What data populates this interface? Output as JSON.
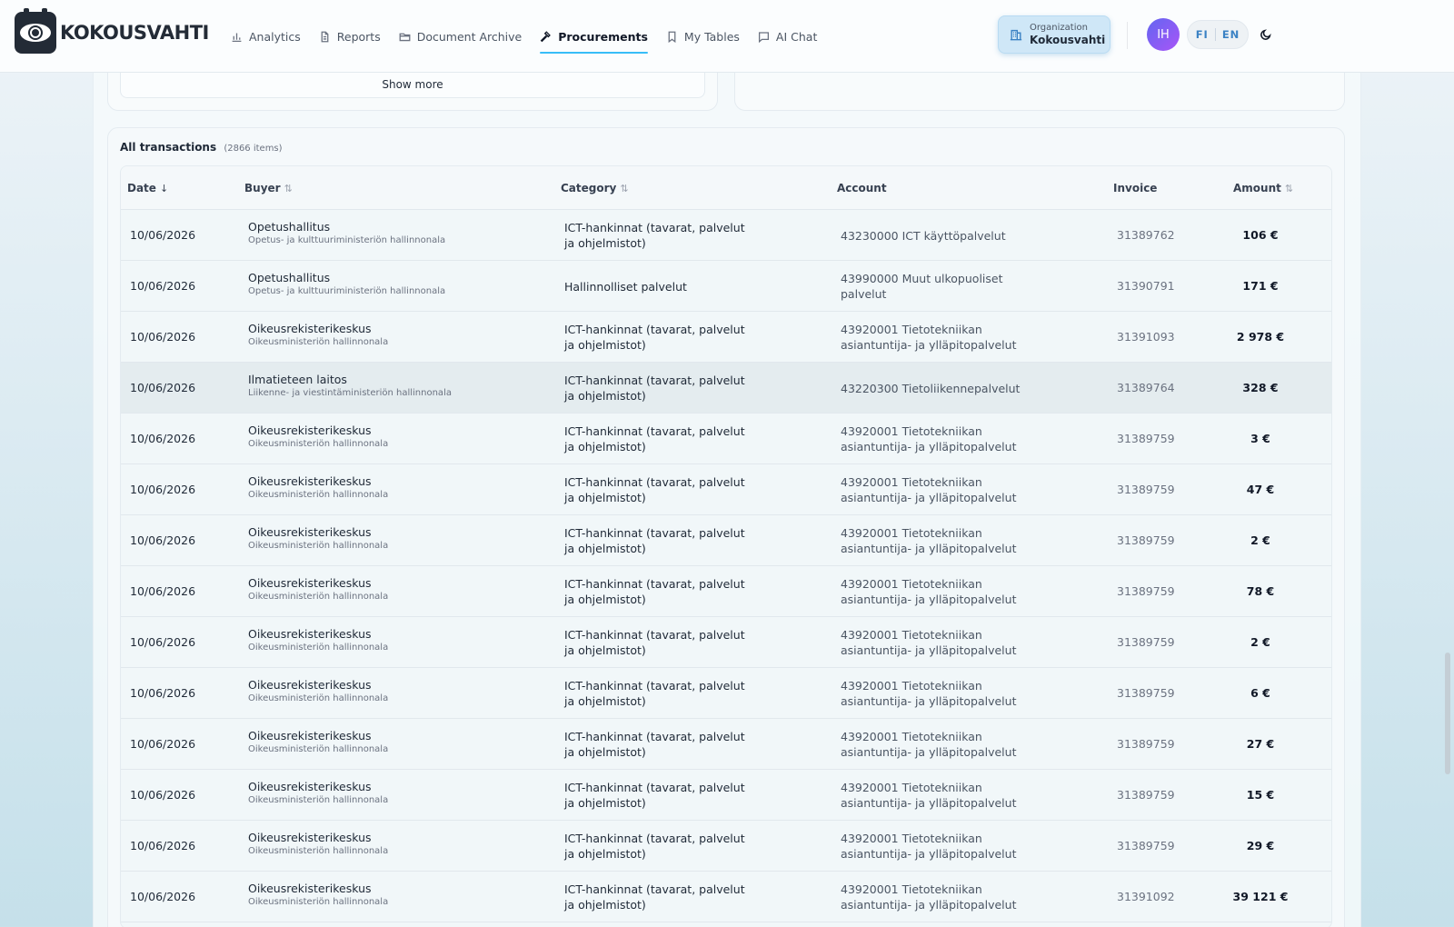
{
  "app": {
    "logo_text": "KOKOUSVAHTI"
  },
  "nav": {
    "items": [
      {
        "label": "Analytics",
        "icon": "bar-chart-icon"
      },
      {
        "label": "Reports",
        "icon": "document-icon"
      },
      {
        "label": "Document Archive",
        "icon": "folder-icon"
      },
      {
        "label": "Procurements",
        "icon": "gavel-icon",
        "active": true
      },
      {
        "label": "My Tables",
        "icon": "bookmark-icon"
      },
      {
        "label": "AI Chat",
        "icon": "chat-icon"
      }
    ]
  },
  "org": {
    "label": "Organization",
    "name": "Kokousvahti"
  },
  "user": {
    "initials": "IH"
  },
  "lang": {
    "fi": "FI",
    "en": "EN"
  },
  "show_more": "Show more",
  "transactions": {
    "title": "All transactions",
    "count": "(2866 items)",
    "columns": {
      "date": "Date",
      "buyer": "Buyer",
      "category": "Category",
      "account": "Account",
      "invoice": "Invoice",
      "amount": "Amount"
    },
    "rows": [
      {
        "date": "10/06/2026",
        "buyer": "Opetushallitus",
        "ministry": "Opetus- ja kulttuuriministeriön hallinnonala",
        "category": "ICT-hankinnat (tavarat, palvelut ja ohjelmistot)",
        "account": "43230000 ICT käyttöpalvelut",
        "invoice": "31389762",
        "amount": "106 €"
      },
      {
        "date": "10/06/2026",
        "buyer": "Opetushallitus",
        "ministry": "Opetus- ja kulttuuriministeriön hallinnonala",
        "category": "Hallinnolliset palvelut",
        "account": "43990000 Muut ulkopuoliset palvelut",
        "invoice": "31390791",
        "amount": "171 €"
      },
      {
        "date": "10/06/2026",
        "buyer": "Oikeusrekisterikeskus",
        "ministry": "Oikeusministeriön hallinnonala",
        "category": "ICT-hankinnat (tavarat, palvelut ja ohjelmistot)",
        "account": "43920001 Tietotekniikan asiantuntija- ja ylläpitopalvelut",
        "invoice": "31391093",
        "amount": "2 978 €"
      },
      {
        "date": "10/06/2026",
        "buyer": "Ilmatieteen laitos",
        "ministry": "Liikenne- ja viestintäministeriön hallinnonala",
        "category": "ICT-hankinnat (tavarat, palvelut ja ohjelmistot)",
        "account": "43220300 Tietoliikennepalvelut",
        "invoice": "31389764",
        "amount": "328 €"
      },
      {
        "date": "10/06/2026",
        "buyer": "Oikeusrekisterikeskus",
        "ministry": "Oikeusministeriön hallinnonala",
        "category": "ICT-hankinnat (tavarat, palvelut ja ohjelmistot)",
        "account": "43920001 Tietotekniikan asiantuntija- ja ylläpitopalvelut",
        "invoice": "31389759",
        "amount": "3 €"
      },
      {
        "date": "10/06/2026",
        "buyer": "Oikeusrekisterikeskus",
        "ministry": "Oikeusministeriön hallinnonala",
        "category": "ICT-hankinnat (tavarat, palvelut ja ohjelmistot)",
        "account": "43920001 Tietotekniikan asiantuntija- ja ylläpitopalvelut",
        "invoice": "31389759",
        "amount": "47 €"
      },
      {
        "date": "10/06/2026",
        "buyer": "Oikeusrekisterikeskus",
        "ministry": "Oikeusministeriön hallinnonala",
        "category": "ICT-hankinnat (tavarat, palvelut ja ohjelmistot)",
        "account": "43920001 Tietotekniikan asiantuntija- ja ylläpitopalvelut",
        "invoice": "31389759",
        "amount": "2 €"
      },
      {
        "date": "10/06/2026",
        "buyer": "Oikeusrekisterikeskus",
        "ministry": "Oikeusministeriön hallinnonala",
        "category": "ICT-hankinnat (tavarat, palvelut ja ohjelmistot)",
        "account": "43920001 Tietotekniikan asiantuntija- ja ylläpitopalvelut",
        "invoice": "31389759",
        "amount": "78 €"
      },
      {
        "date": "10/06/2026",
        "buyer": "Oikeusrekisterikeskus",
        "ministry": "Oikeusministeriön hallinnonala",
        "category": "ICT-hankinnat (tavarat, palvelut ja ohjelmistot)",
        "account": "43920001 Tietotekniikan asiantuntija- ja ylläpitopalvelut",
        "invoice": "31389759",
        "amount": "2 €"
      },
      {
        "date": "10/06/2026",
        "buyer": "Oikeusrekisterikeskus",
        "ministry": "Oikeusministeriön hallinnonala",
        "category": "ICT-hankinnat (tavarat, palvelut ja ohjelmistot)",
        "account": "43920001 Tietotekniikan asiantuntija- ja ylläpitopalvelut",
        "invoice": "31389759",
        "amount": "6 €"
      },
      {
        "date": "10/06/2026",
        "buyer": "Oikeusrekisterikeskus",
        "ministry": "Oikeusministeriön hallinnonala",
        "category": "ICT-hankinnat (tavarat, palvelut ja ohjelmistot)",
        "account": "43920001 Tietotekniikan asiantuntija- ja ylläpitopalvelut",
        "invoice": "31389759",
        "amount": "27 €"
      },
      {
        "date": "10/06/2026",
        "buyer": "Oikeusrekisterikeskus",
        "ministry": "Oikeusministeriön hallinnonala",
        "category": "ICT-hankinnat (tavarat, palvelut ja ohjelmistot)",
        "account": "43920001 Tietotekniikan asiantuntija- ja ylläpitopalvelut",
        "invoice": "31389759",
        "amount": "15 €"
      },
      {
        "date": "10/06/2026",
        "buyer": "Oikeusrekisterikeskus",
        "ministry": "Oikeusministeriön hallinnonala",
        "category": "ICT-hankinnat (tavarat, palvelut ja ohjelmistot)",
        "account": "43920001 Tietotekniikan asiantuntija- ja ylläpitopalvelut",
        "invoice": "31389759",
        "amount": "29 €"
      },
      {
        "date": "10/06/2026",
        "buyer": "Oikeusrekisterikeskus",
        "ministry": "Oikeusministeriön hallinnonala",
        "category": "ICT-hankinnat (tavarat, palvelut ja ohjelmistot)",
        "account": "43920001 Tietotekniikan asiantuntija- ja ylläpitopalvelut",
        "invoice": "31391092",
        "amount": "39 121 €"
      }
    ]
  }
}
